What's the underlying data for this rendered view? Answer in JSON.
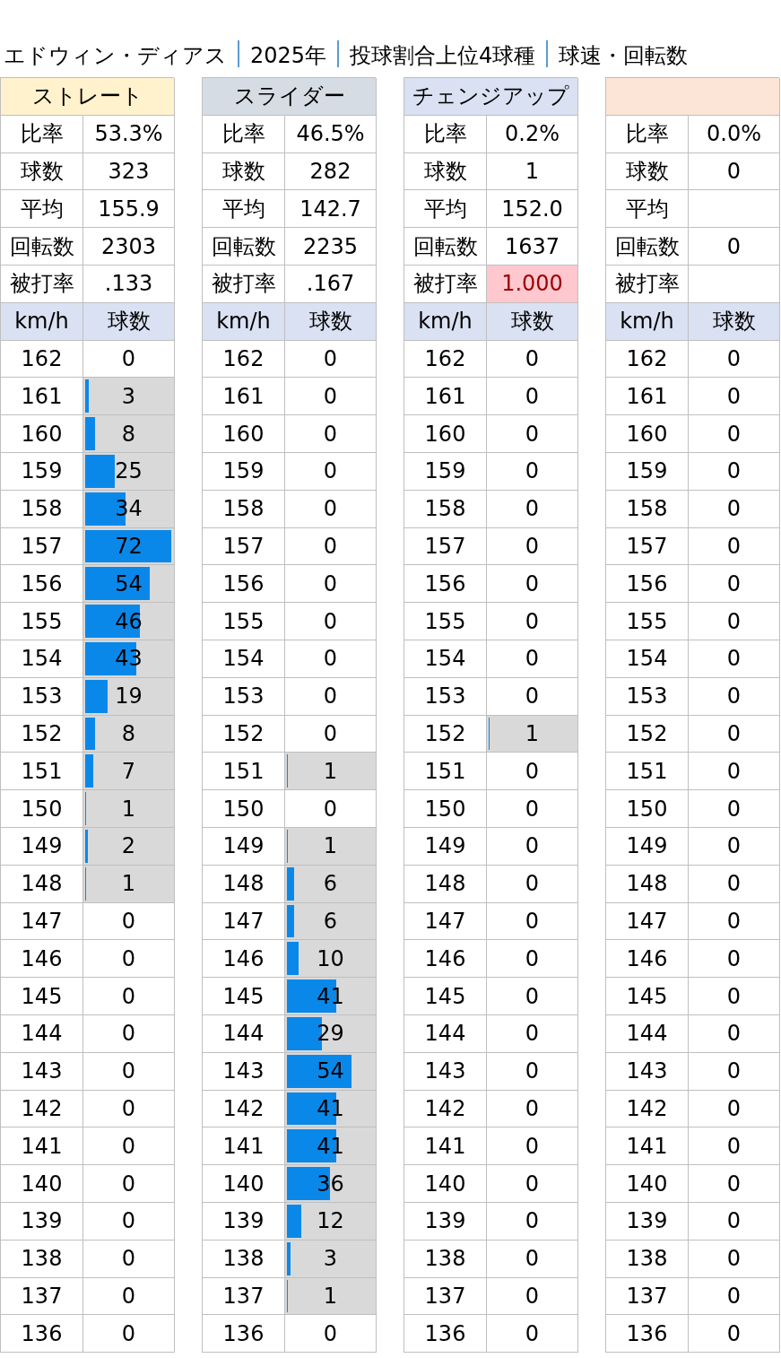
{
  "title": [
    "エドウィン・ディアス",
    "2025年",
    "投球割合上位4球種",
    "球速・回転数"
  ],
  "pitches": [
    {
      "name": "ストレート",
      "color": "#fff2cc",
      "stats": [
        {
          "label": "比率",
          "value": "53.3%",
          "highlight": false
        },
        {
          "label": "球数",
          "value": "323",
          "highlight": false
        },
        {
          "label": "平均",
          "value": "155.9",
          "highlight": false
        },
        {
          "label": "回転数",
          "value": "2303",
          "highlight": false
        },
        {
          "label": "被打率",
          "value": ".133",
          "highlight": false
        }
      ],
      "columns": [
        "km/h",
        "球数"
      ],
      "rows": [
        {
          "kmh": "162",
          "count": "0"
        },
        {
          "kmh": "161",
          "count": "3",
          "level": 0.042
        },
        {
          "kmh": "160",
          "count": "8",
          "level": 0.111
        },
        {
          "kmh": "159",
          "count": "25",
          "level": 0.347
        },
        {
          "kmh": "158",
          "count": "34",
          "level": 0.472
        },
        {
          "kmh": "157",
          "count": "72",
          "level": 1
        },
        {
          "kmh": "156",
          "count": "54",
          "level": 0.75
        },
        {
          "kmh": "155",
          "count": "46",
          "level": 0.639
        },
        {
          "kmh": "154",
          "count": "43",
          "level": 0.597
        },
        {
          "kmh": "153",
          "count": "19",
          "level": 0.264
        },
        {
          "kmh": "152",
          "count": "8",
          "level": 0.111
        },
        {
          "kmh": "151",
          "count": "7",
          "level": 0.097
        },
        {
          "kmh": "150",
          "count": "1",
          "level": 0.014
        },
        {
          "kmh": "149",
          "count": "2",
          "level": 0.028
        },
        {
          "kmh": "148",
          "count": "1",
          "level": 0.014
        },
        {
          "kmh": "147",
          "count": "0"
        },
        {
          "kmh": "146",
          "count": "0"
        },
        {
          "kmh": "145",
          "count": "0"
        },
        {
          "kmh": "144",
          "count": "0"
        },
        {
          "kmh": "143",
          "count": "0"
        },
        {
          "kmh": "142",
          "count": "0"
        },
        {
          "kmh": "141",
          "count": "0"
        },
        {
          "kmh": "140",
          "count": "0"
        },
        {
          "kmh": "139",
          "count": "0"
        },
        {
          "kmh": "138",
          "count": "0"
        },
        {
          "kmh": "137",
          "count": "0"
        },
        {
          "kmh": "136",
          "count": "0"
        }
      ]
    },
    {
      "name": "スライダー",
      "color": "#d6dce4",
      "stats": [
        {
          "label": "比率",
          "value": "46.5%",
          "highlight": false
        },
        {
          "label": "球数",
          "value": "282",
          "highlight": false
        },
        {
          "label": "平均",
          "value": "142.7",
          "highlight": false
        },
        {
          "label": "回転数",
          "value": "2235",
          "highlight": false
        },
        {
          "label": "被打率",
          "value": ".167",
          "highlight": false
        }
      ],
      "columns": [
        "km/h",
        "球数"
      ],
      "rows": [
        {
          "kmh": "162",
          "count": "0"
        },
        {
          "kmh": "161",
          "count": "0"
        },
        {
          "kmh": "160",
          "count": "0"
        },
        {
          "kmh": "159",
          "count": "0"
        },
        {
          "kmh": "158",
          "count": "0"
        },
        {
          "kmh": "157",
          "count": "0"
        },
        {
          "kmh": "156",
          "count": "0"
        },
        {
          "kmh": "155",
          "count": "0"
        },
        {
          "kmh": "154",
          "count": "0"
        },
        {
          "kmh": "153",
          "count": "0"
        },
        {
          "kmh": "152",
          "count": "0"
        },
        {
          "kmh": "151",
          "count": "1",
          "level": 0.014
        },
        {
          "kmh": "150",
          "count": "0"
        },
        {
          "kmh": "149",
          "count": "1",
          "level": 0.014
        },
        {
          "kmh": "148",
          "count": "6",
          "level": 0.083
        },
        {
          "kmh": "147",
          "count": "6",
          "level": 0.083
        },
        {
          "kmh": "146",
          "count": "10",
          "level": 0.139
        },
        {
          "kmh": "145",
          "count": "41",
          "level": 0.569
        },
        {
          "kmh": "144",
          "count": "29",
          "level": 0.403
        },
        {
          "kmh": "143",
          "count": "54",
          "level": 0.75
        },
        {
          "kmh": "142",
          "count": "41",
          "level": 0.569
        },
        {
          "kmh": "141",
          "count": "41",
          "level": 0.569
        },
        {
          "kmh": "140",
          "count": "36",
          "level": 0.5
        },
        {
          "kmh": "139",
          "count": "12",
          "level": 0.167
        },
        {
          "kmh": "138",
          "count": "3",
          "level": 0.042
        },
        {
          "kmh": "137",
          "count": "1",
          "level": 0.014
        },
        {
          "kmh": "136",
          "count": "0"
        }
      ]
    },
    {
      "name": "チェンジアップ",
      "color": "#d9e1f2",
      "stats": [
        {
          "label": "比率",
          "value": "0.2%",
          "highlight": false
        },
        {
          "label": "球数",
          "value": "1",
          "highlight": false
        },
        {
          "label": "平均",
          "value": "152.0",
          "highlight": false
        },
        {
          "label": "回転数",
          "value": "1637",
          "highlight": false
        },
        {
          "label": "被打率",
          "value": "1.000",
          "highlight": true
        }
      ],
      "columns": [
        "km/h",
        "球数"
      ],
      "rows": [
        {
          "kmh": "162",
          "count": "0"
        },
        {
          "kmh": "161",
          "count": "0"
        },
        {
          "kmh": "160",
          "count": "0"
        },
        {
          "kmh": "159",
          "count": "0"
        },
        {
          "kmh": "158",
          "count": "0"
        },
        {
          "kmh": "157",
          "count": "0"
        },
        {
          "kmh": "156",
          "count": "0"
        },
        {
          "kmh": "155",
          "count": "0"
        },
        {
          "kmh": "154",
          "count": "0"
        },
        {
          "kmh": "153",
          "count": "0"
        },
        {
          "kmh": "152",
          "count": "1",
          "level": 0.014
        },
        {
          "kmh": "151",
          "count": "0"
        },
        {
          "kmh": "150",
          "count": "0"
        },
        {
          "kmh": "149",
          "count": "0"
        },
        {
          "kmh": "148",
          "count": "0"
        },
        {
          "kmh": "147",
          "count": "0"
        },
        {
          "kmh": "146",
          "count": "0"
        },
        {
          "kmh": "145",
          "count": "0"
        },
        {
          "kmh": "144",
          "count": "0"
        },
        {
          "kmh": "143",
          "count": "0"
        },
        {
          "kmh": "142",
          "count": "0"
        },
        {
          "kmh": "141",
          "count": "0"
        },
        {
          "kmh": "140",
          "count": "0"
        },
        {
          "kmh": "139",
          "count": "0"
        },
        {
          "kmh": "138",
          "count": "0"
        },
        {
          "kmh": "137",
          "count": "0"
        },
        {
          "kmh": "136",
          "count": "0"
        }
      ]
    },
    {
      "color": "#fce4d6",
      "stats": [
        {
          "label": "比率",
          "value": "0.0%",
          "highlight": false
        },
        {
          "label": "球数",
          "value": "0",
          "highlight": false
        },
        {
          "label": "平均",
          "highlight": false
        },
        {
          "label": "回転数",
          "value": "0",
          "highlight": false
        },
        {
          "label": "被打率",
          "highlight": false
        }
      ],
      "columns": [
        "km/h",
        "球数"
      ],
      "rows": [
        {
          "kmh": "162",
          "count": "0"
        },
        {
          "kmh": "161",
          "count": "0"
        },
        {
          "kmh": "160",
          "count": "0"
        },
        {
          "kmh": "159",
          "count": "0"
        },
        {
          "kmh": "158",
          "count": "0"
        },
        {
          "kmh": "157",
          "count": "0"
        },
        {
          "kmh": "156",
          "count": "0"
        },
        {
          "kmh": "155",
          "count": "0"
        },
        {
          "kmh": "154",
          "count": "0"
        },
        {
          "kmh": "153",
          "count": "0"
        },
        {
          "kmh": "152",
          "count": "0"
        },
        {
          "kmh": "151",
          "count": "0"
        },
        {
          "kmh": "150",
          "count": "0"
        },
        {
          "kmh": "149",
          "count": "0"
        },
        {
          "kmh": "148",
          "count": "0"
        },
        {
          "kmh": "147",
          "count": "0"
        },
        {
          "kmh": "146",
          "count": "0"
        },
        {
          "kmh": "145",
          "count": "0"
        },
        {
          "kmh": "144",
          "count": "0"
        },
        {
          "kmh": "143",
          "count": "0"
        },
        {
          "kmh": "142",
          "count": "0"
        },
        {
          "kmh": "141",
          "count": "0"
        },
        {
          "kmh": "140",
          "count": "0"
        },
        {
          "kmh": "139",
          "count": "0"
        },
        {
          "kmh": "138",
          "count": "0"
        },
        {
          "kmh": "137",
          "count": "0"
        },
        {
          "kmh": "136",
          "count": "0"
        }
      ]
    }
  ]
}
